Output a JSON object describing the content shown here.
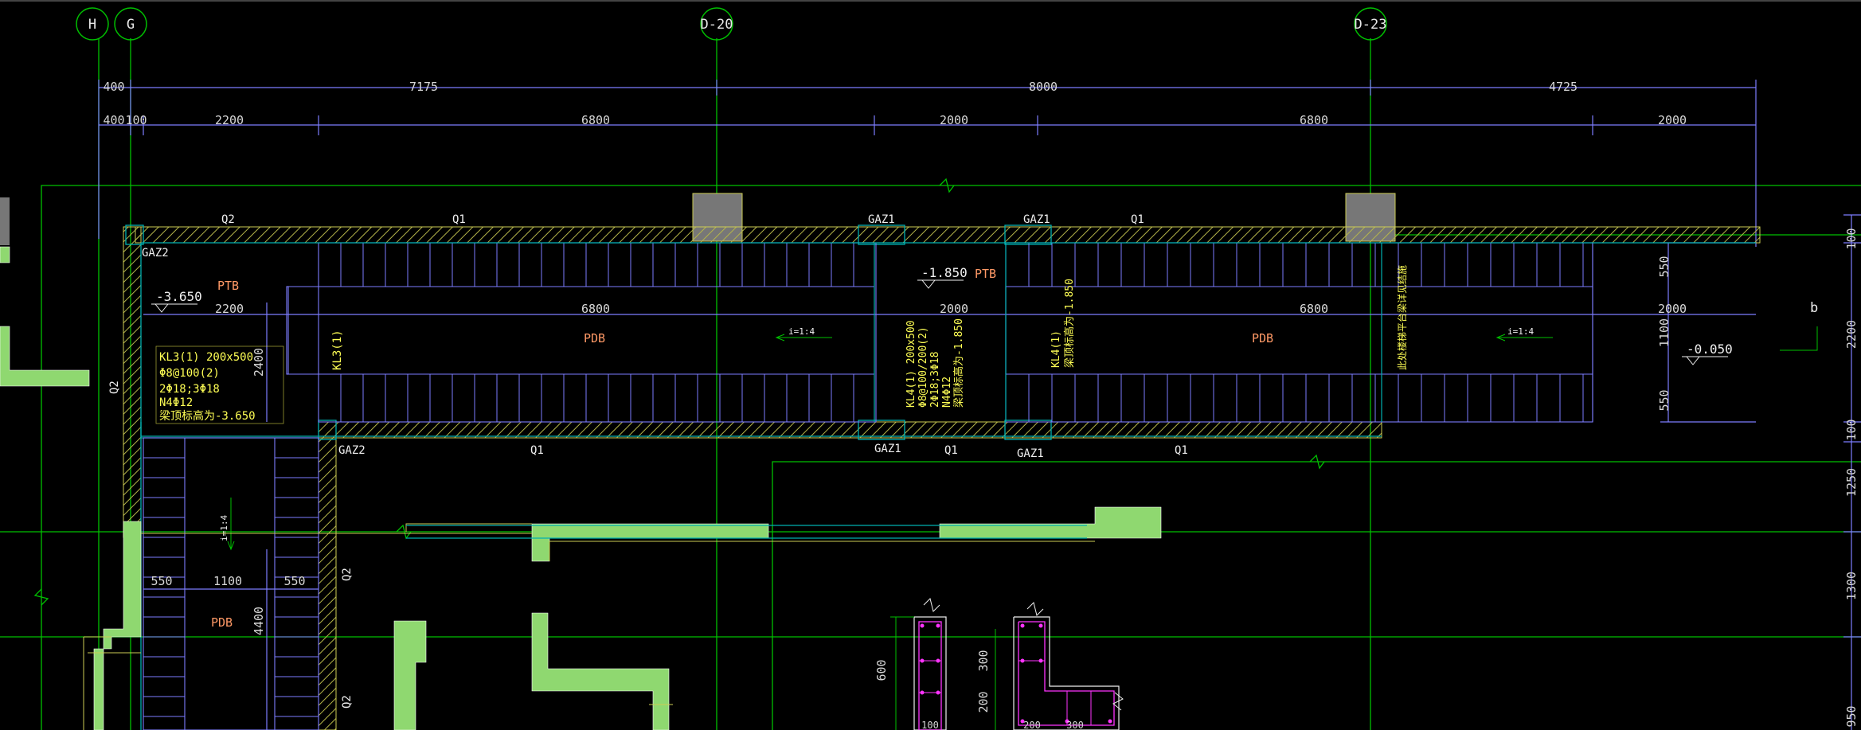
{
  "colors": {
    "background": "#000000",
    "grid_axis": "#00c000",
    "dimension": "#7d7dff",
    "wall_outline": "#00b0b0",
    "hatch": "#cccc55",
    "column_fill": "#777777",
    "green_fill": "#8fd870",
    "yellow_text": "#ffff55",
    "orange_text": "#ff9966",
    "magenta": "#ff33ff"
  },
  "axes": {
    "H": "H",
    "G": "G",
    "D20": "D-20",
    "D23": "D-23",
    "b": "b"
  },
  "dims_top_row1": [
    "400",
    "7175",
    "8000",
    "4725"
  ],
  "dims_top_row2": [
    "400",
    "100",
    "2200",
    "6800",
    "2000",
    "6800",
    "2000"
  ],
  "dims_mid": [
    "2200",
    "6800",
    "2000",
    "6800",
    "2000"
  ],
  "dims_right": [
    "550",
    "1100",
    "550",
    "100",
    "2200",
    "100",
    "1250",
    "1300",
    "950"
  ],
  "dims_left": [
    "2400",
    "4400",
    "600",
    "300",
    "200"
  ],
  "dims_bottom_left": [
    "550",
    "1100",
    "550"
  ],
  "dims_detail": [
    "100",
    "200",
    "300"
  ],
  "labels": {
    "Q2": "Q2",
    "Q1": "Q1",
    "GAZ1": "GAZ1",
    "GAZ2": "GAZ2",
    "PTB": "PTB",
    "PDB": "PDB",
    "elev_3650": "-3.650",
    "elev_1850": "-1.850",
    "elev_0050": "-0.050",
    "slope": "i=1:4",
    "kl3": "KL3(1)"
  },
  "annotations": {
    "kl3_block": [
      "KL3(1) 200x500",
      "Φ8@100(2)",
      "2Φ18;3Φ18",
      "N4Φ12",
      "梁顶标高为-3.650"
    ],
    "kl4_block": [
      "KL4(1) 200x500",
      "Φ8@100/200(2)",
      "2Φ18;3Φ18",
      "N4Φ12",
      "梁顶标高为-1.850"
    ],
    "kl4_short": [
      "KL4(1)",
      "梁顶标高为-1.850"
    ],
    "vertical_note": "此处楼梯平台梁详见结施"
  }
}
